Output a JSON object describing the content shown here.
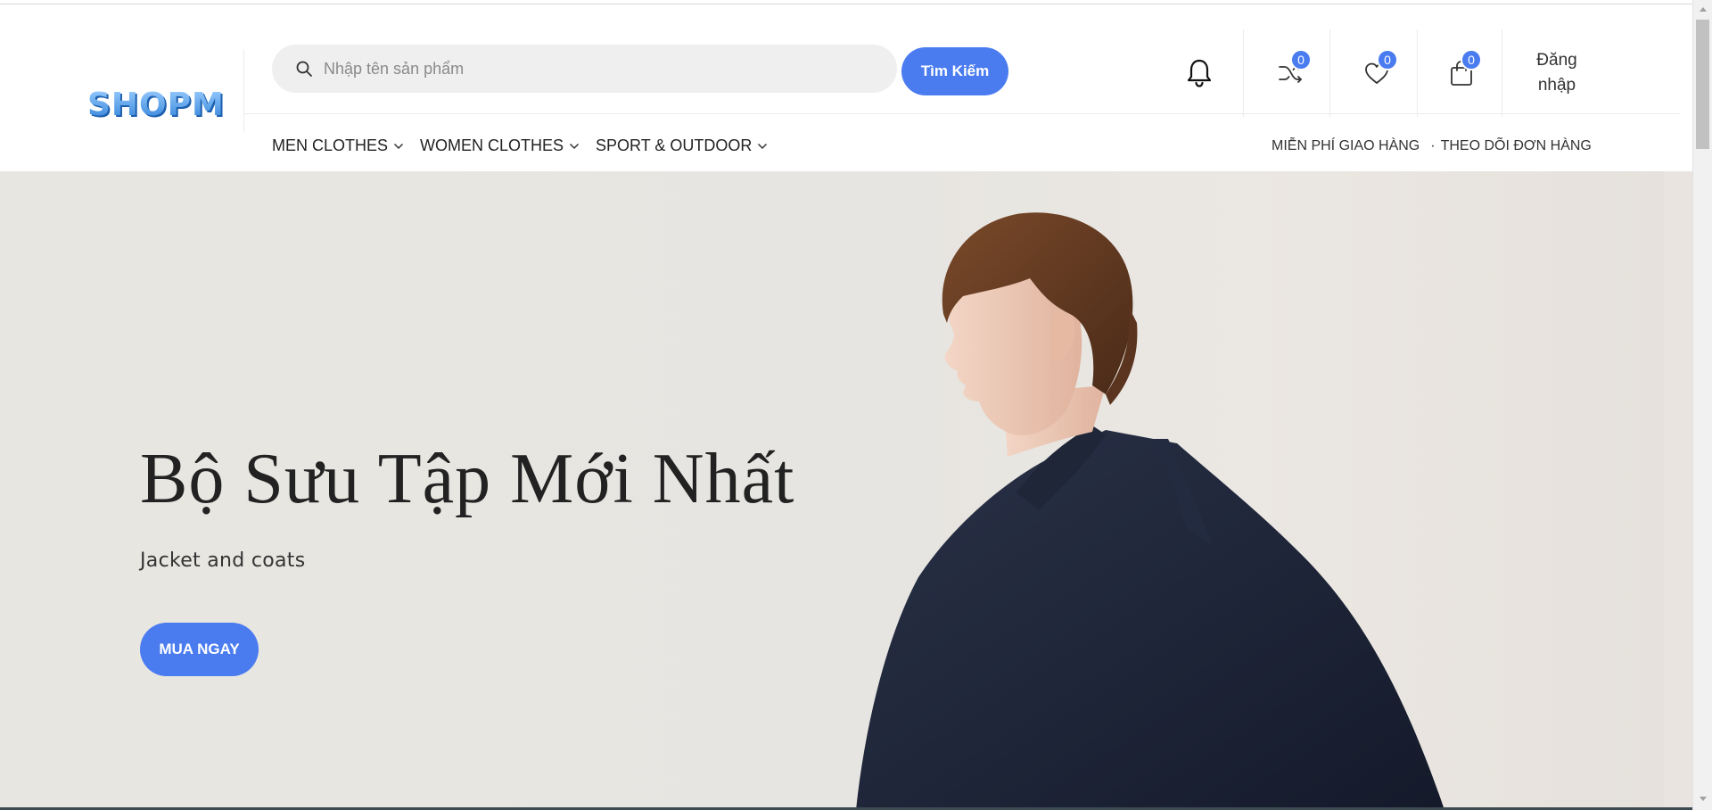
{
  "header": {
    "logo_text": "SHOPM",
    "search": {
      "placeholder": "Nhập tên sản phẩm",
      "value": ""
    },
    "search_button_label": "Tìm Kiếm",
    "icons": {
      "compare_count": "0",
      "wishlist_count": "0",
      "cart_count": "0"
    },
    "login_label": "Đăng nhập"
  },
  "nav": {
    "items": [
      {
        "label": "MEN CLOTHES"
      },
      {
        "label": "WOMEN CLOTHES"
      },
      {
        "label": "SPORT & OUTDOOR"
      }
    ],
    "free_shipping": "MIỄN PHÍ GIAO HÀNG",
    "dot": "·",
    "track_order": "THEO DÕI ĐƠN HÀNG"
  },
  "hero": {
    "title": "Bộ Sưu Tập Mới Nhất",
    "subtitle": "Jacket and coats",
    "button_label": "MUA NGAY"
  },
  "colors": {
    "accent": "#4a7cf0",
    "hero_bg": "#e8e6e1",
    "jacket": "#1c2437"
  }
}
